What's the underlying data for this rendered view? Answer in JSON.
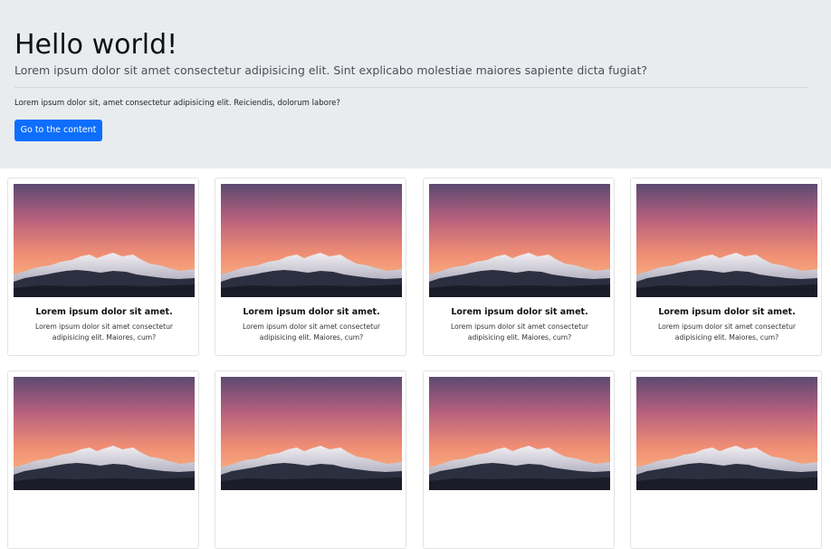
{
  "hero": {
    "title": "Hello world!",
    "lead": "Lorem ipsum dolor sit amet consectetur adipisicing elit. Sint explicabo molestiae maiores sapiente dicta fugiat?",
    "text": "Lorem ipsum dolor sit, amet consectetur adipisicing elit. Reiciendis, dolorum labore?",
    "button_label": "Go to the content"
  },
  "cards": [
    {
      "title": "Lorem ipsum dolor sit amet.",
      "text": "Lorem ipsum dolor sit amet consectetur adipisicing elit. Maiores, cum?"
    },
    {
      "title": "Lorem ipsum dolor sit amet.",
      "text": "Lorem ipsum dolor sit amet consectetur adipisicing elit. Maiores, cum?"
    },
    {
      "title": "Lorem ipsum dolor sit amet.",
      "text": "Lorem ipsum dolor sit amet consectetur adipisicing elit. Maiores, cum?"
    },
    {
      "title": "Lorem ipsum dolor sit amet.",
      "text": "Lorem ipsum dolor sit amet consectetur adipisicing elit. Maiores, cum?"
    },
    {
      "title": "",
      "text": ""
    },
    {
      "title": "",
      "text": ""
    },
    {
      "title": "",
      "text": ""
    },
    {
      "title": "",
      "text": ""
    }
  ],
  "colors": {
    "hero_background": "#e9ecef",
    "primary_button": "#0d6efd",
    "sky_top": "#5b4a6e",
    "sky_glow": "#f89a6e"
  },
  "image": {
    "subject": "mountain-sunset"
  }
}
